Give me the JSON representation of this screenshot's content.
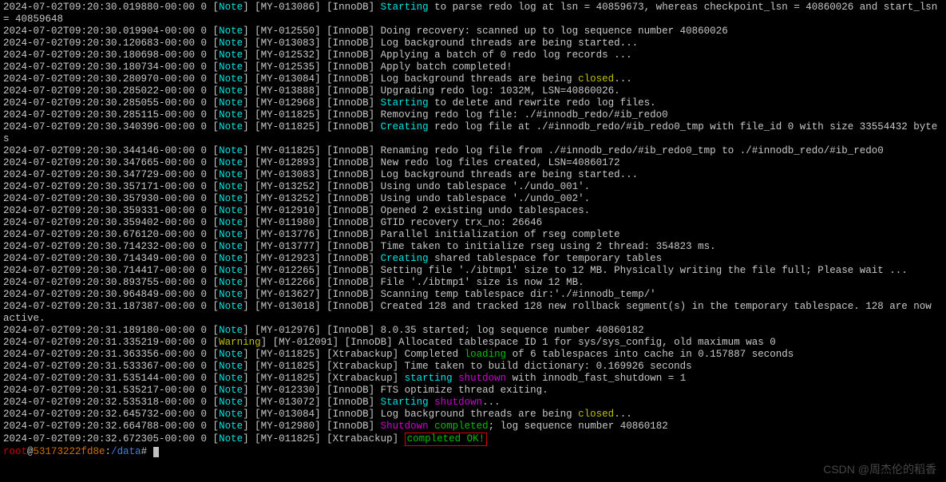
{
  "lines": [
    {
      "segments": [
        {
          "class": "white",
          "t": "2024-07-02T09:20:30.019880-00:00 0 "
        },
        {
          "class": "bracket",
          "t": "["
        },
        {
          "class": "cyan",
          "t": "Note"
        },
        {
          "class": "bracket",
          "t": "] "
        },
        {
          "class": "white",
          "t": "[MY-013086] [InnoDB] "
        },
        {
          "class": "cyan",
          "t": "Starting"
        },
        {
          "class": "white",
          "t": " to parse redo log at lsn = 40859673, whereas checkpoint_lsn = 40860026 and start_lsn = 40859648"
        }
      ]
    },
    {
      "segments": [
        {
          "class": "white",
          "t": "2024-07-02T09:20:30.019904-00:00 0 "
        },
        {
          "class": "bracket",
          "t": "["
        },
        {
          "class": "cyan",
          "t": "Note"
        },
        {
          "class": "bracket",
          "t": "] "
        },
        {
          "class": "white",
          "t": "[MY-012550] [InnoDB] Doing recovery: scanned up to log sequence number 40860026"
        }
      ]
    },
    {
      "segments": [
        {
          "class": "white",
          "t": "2024-07-02T09:20:30.120683-00:00 0 "
        },
        {
          "class": "bracket",
          "t": "["
        },
        {
          "class": "cyan",
          "t": "Note"
        },
        {
          "class": "bracket",
          "t": "] "
        },
        {
          "class": "white",
          "t": "[MY-013083] [InnoDB] Log background threads are being started..."
        }
      ]
    },
    {
      "segments": [
        {
          "class": "white",
          "t": "2024-07-02T09:20:30.180698-00:00 0 "
        },
        {
          "class": "bracket",
          "t": "["
        },
        {
          "class": "cyan",
          "t": "Note"
        },
        {
          "class": "bracket",
          "t": "] "
        },
        {
          "class": "white",
          "t": "[MY-012532] [InnoDB] Applying a batch of 0 redo log records ..."
        }
      ]
    },
    {
      "segments": [
        {
          "class": "white",
          "t": "2024-07-02T09:20:30.180734-00:00 0 "
        },
        {
          "class": "bracket",
          "t": "["
        },
        {
          "class": "cyan",
          "t": "Note"
        },
        {
          "class": "bracket",
          "t": "] "
        },
        {
          "class": "white",
          "t": "[MY-012535] [InnoDB] Apply batch completed!"
        }
      ]
    },
    {
      "segments": [
        {
          "class": "white",
          "t": "2024-07-02T09:20:30.280970-00:00 0 "
        },
        {
          "class": "bracket",
          "t": "["
        },
        {
          "class": "cyan",
          "t": "Note"
        },
        {
          "class": "bracket",
          "t": "] "
        },
        {
          "class": "white",
          "t": "[MY-013084] [InnoDB] Log background threads are being "
        },
        {
          "class": "yellow",
          "t": "closed"
        },
        {
          "class": "white",
          "t": "..."
        }
      ]
    },
    {
      "segments": [
        {
          "class": "white",
          "t": "2024-07-02T09:20:30.285022-00:00 0 "
        },
        {
          "class": "bracket",
          "t": "["
        },
        {
          "class": "cyan",
          "t": "Note"
        },
        {
          "class": "bracket",
          "t": "] "
        },
        {
          "class": "white",
          "t": "[MY-013888] [InnoDB] Upgrading redo log: 1032M, LSN=40860026."
        }
      ]
    },
    {
      "segments": [
        {
          "class": "white",
          "t": "2024-07-02T09:20:30.285055-00:00 0 "
        },
        {
          "class": "bracket",
          "t": "["
        },
        {
          "class": "cyan",
          "t": "Note"
        },
        {
          "class": "bracket",
          "t": "] "
        },
        {
          "class": "white",
          "t": "[MY-012968] [InnoDB] "
        },
        {
          "class": "cyan",
          "t": "Starting"
        },
        {
          "class": "white",
          "t": " to delete and rewrite redo log files."
        }
      ]
    },
    {
      "segments": [
        {
          "class": "white",
          "t": "2024-07-02T09:20:30.285115-00:00 0 "
        },
        {
          "class": "bracket",
          "t": "["
        },
        {
          "class": "cyan",
          "t": "Note"
        },
        {
          "class": "bracket",
          "t": "] "
        },
        {
          "class": "white",
          "t": "[MY-011825] [InnoDB] Removing redo log file: ./#innodb_redo/#ib_redo0"
        }
      ]
    },
    {
      "segments": [
        {
          "class": "white",
          "t": "2024-07-02T09:20:30.340396-00:00 0 "
        },
        {
          "class": "bracket",
          "t": "["
        },
        {
          "class": "cyan",
          "t": "Note"
        },
        {
          "class": "bracket",
          "t": "] "
        },
        {
          "class": "white",
          "t": "[MY-011825] [InnoDB] "
        },
        {
          "class": "cyan",
          "t": "Creating"
        },
        {
          "class": "white",
          "t": " redo log file at ./#innodb_redo/#ib_redo0_tmp with file_id 0 with size 33554432 bytes"
        }
      ]
    },
    {
      "segments": [
        {
          "class": "white",
          "t": "2024-07-02T09:20:30.344146-00:00 0 "
        },
        {
          "class": "bracket",
          "t": "["
        },
        {
          "class": "cyan",
          "t": "Note"
        },
        {
          "class": "bracket",
          "t": "] "
        },
        {
          "class": "white",
          "t": "[MY-011825] [InnoDB] Renaming redo log file from ./#innodb_redo/#ib_redo0_tmp to ./#innodb_redo/#ib_redo0"
        }
      ]
    },
    {
      "segments": [
        {
          "class": "white",
          "t": "2024-07-02T09:20:30.347665-00:00 0 "
        },
        {
          "class": "bracket",
          "t": "["
        },
        {
          "class": "cyan",
          "t": "Note"
        },
        {
          "class": "bracket",
          "t": "] "
        },
        {
          "class": "white",
          "t": "[MY-012893] [InnoDB] New redo log files created, LSN=40860172"
        }
      ]
    },
    {
      "segments": [
        {
          "class": "white",
          "t": "2024-07-02T09:20:30.347729-00:00 0 "
        },
        {
          "class": "bracket",
          "t": "["
        },
        {
          "class": "cyan",
          "t": "Note"
        },
        {
          "class": "bracket",
          "t": "] "
        },
        {
          "class": "white",
          "t": "[MY-013083] [InnoDB] Log background threads are being started..."
        }
      ]
    },
    {
      "segments": [
        {
          "class": "white",
          "t": "2024-07-02T09:20:30.357171-00:00 0 "
        },
        {
          "class": "bracket",
          "t": "["
        },
        {
          "class": "cyan",
          "t": "Note"
        },
        {
          "class": "bracket",
          "t": "] "
        },
        {
          "class": "white",
          "t": "[MY-013252] [InnoDB] Using undo tablespace './undo_001'."
        }
      ]
    },
    {
      "segments": [
        {
          "class": "white",
          "t": "2024-07-02T09:20:30.357930-00:00 0 "
        },
        {
          "class": "bracket",
          "t": "["
        },
        {
          "class": "cyan",
          "t": "Note"
        },
        {
          "class": "bracket",
          "t": "] "
        },
        {
          "class": "white",
          "t": "[MY-013252] [InnoDB] Using undo tablespace './undo_002'."
        }
      ]
    },
    {
      "segments": [
        {
          "class": "white",
          "t": "2024-07-02T09:20:30.359331-00:00 0 "
        },
        {
          "class": "bracket",
          "t": "["
        },
        {
          "class": "cyan",
          "t": "Note"
        },
        {
          "class": "bracket",
          "t": "] "
        },
        {
          "class": "white",
          "t": "[MY-012910] [InnoDB] Opened 2 existing undo tablespaces."
        }
      ]
    },
    {
      "segments": [
        {
          "class": "white",
          "t": "2024-07-02T09:20:30.359402-00:00 0 "
        },
        {
          "class": "bracket",
          "t": "["
        },
        {
          "class": "cyan",
          "t": "Note"
        },
        {
          "class": "bracket",
          "t": "] "
        },
        {
          "class": "white",
          "t": "[MY-011980] [InnoDB] GTID recovery trx_no: 26646"
        }
      ]
    },
    {
      "segments": [
        {
          "class": "white",
          "t": "2024-07-02T09:20:30.676120-00:00 0 "
        },
        {
          "class": "bracket",
          "t": "["
        },
        {
          "class": "cyan",
          "t": "Note"
        },
        {
          "class": "bracket",
          "t": "] "
        },
        {
          "class": "white",
          "t": "[MY-013776] [InnoDB] Parallel initialization of rseg complete"
        }
      ]
    },
    {
      "segments": [
        {
          "class": "white",
          "t": "2024-07-02T09:20:30.714232-00:00 0 "
        },
        {
          "class": "bracket",
          "t": "["
        },
        {
          "class": "cyan",
          "t": "Note"
        },
        {
          "class": "bracket",
          "t": "] "
        },
        {
          "class": "white",
          "t": "[MY-013777] [InnoDB] Time taken to initialize rseg using 2 thread: 354823 ms."
        }
      ]
    },
    {
      "segments": [
        {
          "class": "white",
          "t": "2024-07-02T09:20:30.714349-00:00 0 "
        },
        {
          "class": "bracket",
          "t": "["
        },
        {
          "class": "cyan",
          "t": "Note"
        },
        {
          "class": "bracket",
          "t": "] "
        },
        {
          "class": "white",
          "t": "[MY-012923] [InnoDB] "
        },
        {
          "class": "cyan",
          "t": "Creating"
        },
        {
          "class": "white",
          "t": " shared tablespace for temporary tables"
        }
      ]
    },
    {
      "segments": [
        {
          "class": "white",
          "t": "2024-07-02T09:20:30.714417-00:00 0 "
        },
        {
          "class": "bracket",
          "t": "["
        },
        {
          "class": "cyan",
          "t": "Note"
        },
        {
          "class": "bracket",
          "t": "] "
        },
        {
          "class": "white",
          "t": "[MY-012265] [InnoDB] Setting file './ibtmp1' size to 12 MB. Physically writing the file full; Please wait ..."
        }
      ]
    },
    {
      "segments": [
        {
          "class": "white",
          "t": "2024-07-02T09:20:30.893755-00:00 0 "
        },
        {
          "class": "bracket",
          "t": "["
        },
        {
          "class": "cyan",
          "t": "Note"
        },
        {
          "class": "bracket",
          "t": "] "
        },
        {
          "class": "white",
          "t": "[MY-012266] [InnoDB] File './ibtmp1' size is now 12 MB."
        }
      ]
    },
    {
      "segments": [
        {
          "class": "white",
          "t": "2024-07-02T09:20:30.964849-00:00 0 "
        },
        {
          "class": "bracket",
          "t": "["
        },
        {
          "class": "cyan",
          "t": "Note"
        },
        {
          "class": "bracket",
          "t": "] "
        },
        {
          "class": "white",
          "t": "[MY-013627] [InnoDB] Scanning temp tablespace dir:'./#innodb_temp/'"
        }
      ]
    },
    {
      "segments": [
        {
          "class": "white",
          "t": "2024-07-02T09:20:31.187387-00:00 0 "
        },
        {
          "class": "bracket",
          "t": "["
        },
        {
          "class": "cyan",
          "t": "Note"
        },
        {
          "class": "bracket",
          "t": "] "
        },
        {
          "class": "white",
          "t": "[MY-013018] [InnoDB] Created 128 and tracked 128 new rollback segment(s) in the temporary tablespace. 128 are now active."
        }
      ]
    },
    {
      "segments": [
        {
          "class": "white",
          "t": "2024-07-02T09:20:31.189180-00:00 0 "
        },
        {
          "class": "bracket",
          "t": "["
        },
        {
          "class": "cyan",
          "t": "Note"
        },
        {
          "class": "bracket",
          "t": "] "
        },
        {
          "class": "white",
          "t": "[MY-012976] [InnoDB] 8.0.35 started; log sequence number 40860182"
        }
      ]
    },
    {
      "segments": [
        {
          "class": "white",
          "t": "2024-07-02T09:20:31.335219-00:00 0 "
        },
        {
          "class": "bracket",
          "t": "["
        },
        {
          "class": "yellow",
          "t": "Warning"
        },
        {
          "class": "bracket",
          "t": "] "
        },
        {
          "class": "white",
          "t": "[MY-012091] [InnoDB] Allocated tablespace ID 1 for sys/sys_config, old maximum was 0"
        }
      ]
    },
    {
      "segments": [
        {
          "class": "white",
          "t": "2024-07-02T09:20:31.363356-00:00 0 "
        },
        {
          "class": "bracket",
          "t": "["
        },
        {
          "class": "cyan",
          "t": "Note"
        },
        {
          "class": "bracket",
          "t": "] "
        },
        {
          "class": "white",
          "t": "[MY-011825] [Xtrabackup] Completed "
        },
        {
          "class": "green",
          "t": "loading"
        },
        {
          "class": "white",
          "t": " of 6 tablespaces into cache in 0.157887 seconds"
        }
      ]
    },
    {
      "segments": [
        {
          "class": "white",
          "t": "2024-07-02T09:20:31.533367-00:00 0 "
        },
        {
          "class": "bracket",
          "t": "["
        },
        {
          "class": "cyan",
          "t": "Note"
        },
        {
          "class": "bracket",
          "t": "] "
        },
        {
          "class": "white",
          "t": "[MY-011825] [Xtrabackup] Time taken to build dictionary: 0.169926 seconds"
        }
      ]
    },
    {
      "segments": [
        {
          "class": "white",
          "t": "2024-07-02T09:20:31.535144-00:00 0 "
        },
        {
          "class": "bracket",
          "t": "["
        },
        {
          "class": "cyan",
          "t": "Note"
        },
        {
          "class": "bracket",
          "t": "] "
        },
        {
          "class": "white",
          "t": "[MY-011825] [Xtrabackup] "
        },
        {
          "class": "cyan",
          "t": "starting"
        },
        {
          "class": "white",
          "t": " "
        },
        {
          "class": "magenta",
          "t": "shutdown"
        },
        {
          "class": "white",
          "t": " with innodb_fast_shutdown = 1"
        }
      ]
    },
    {
      "segments": [
        {
          "class": "white",
          "t": "2024-07-02T09:20:31.535217-00:00 0 "
        },
        {
          "class": "bracket",
          "t": "["
        },
        {
          "class": "cyan",
          "t": "Note"
        },
        {
          "class": "bracket",
          "t": "] "
        },
        {
          "class": "white",
          "t": "[MY-012330] [InnoDB] FTS optimize thread exiting."
        }
      ]
    },
    {
      "segments": [
        {
          "class": "white",
          "t": "2024-07-02T09:20:32.535318-00:00 0 "
        },
        {
          "class": "bracket",
          "t": "["
        },
        {
          "class": "cyan",
          "t": "Note"
        },
        {
          "class": "bracket",
          "t": "] "
        },
        {
          "class": "white",
          "t": "[MY-013072] [InnoDB] "
        },
        {
          "class": "cyan",
          "t": "Starting"
        },
        {
          "class": "white",
          "t": " "
        },
        {
          "class": "magenta",
          "t": "shutdown"
        },
        {
          "class": "white",
          "t": "..."
        }
      ]
    },
    {
      "segments": [
        {
          "class": "white",
          "t": "2024-07-02T09:20:32.645732-00:00 0 "
        },
        {
          "class": "bracket",
          "t": "["
        },
        {
          "class": "cyan",
          "t": "Note"
        },
        {
          "class": "bracket",
          "t": "] "
        },
        {
          "class": "white",
          "t": "[MY-013084] [InnoDB] Log background threads are being "
        },
        {
          "class": "yellow",
          "t": "closed"
        },
        {
          "class": "white",
          "t": "..."
        }
      ]
    },
    {
      "segments": [
        {
          "class": "white",
          "t": "2024-07-02T09:20:32.664788-00:00 0 "
        },
        {
          "class": "bracket",
          "t": "["
        },
        {
          "class": "cyan",
          "t": "Note"
        },
        {
          "class": "bracket",
          "t": "] "
        },
        {
          "class": "white",
          "t": "[MY-012980] [InnoDB] "
        },
        {
          "class": "magenta",
          "t": "Shutdown"
        },
        {
          "class": "white",
          "t": " "
        },
        {
          "class": "green",
          "t": "completed"
        },
        {
          "class": "white",
          "t": "; log sequence number 40860182"
        }
      ]
    },
    {
      "segments": [
        {
          "class": "white",
          "t": "2024-07-02T09:20:32.672305-00:00 0 "
        },
        {
          "class": "bracket",
          "t": "["
        },
        {
          "class": "cyan",
          "t": "Note"
        },
        {
          "class": "bracket",
          "t": "] "
        },
        {
          "class": "white",
          "t": "[MY-011825] [Xtrabackup] "
        }
      ],
      "boxed": {
        "class": "green",
        "t": "completed OK!"
      }
    }
  ],
  "prompt": {
    "user": "root",
    "at": "@",
    "host": "53173222fd8e",
    "colon": ":",
    "path": "/data",
    "symbol": "# "
  },
  "watermark": "CSDN @周杰伦的稻香"
}
